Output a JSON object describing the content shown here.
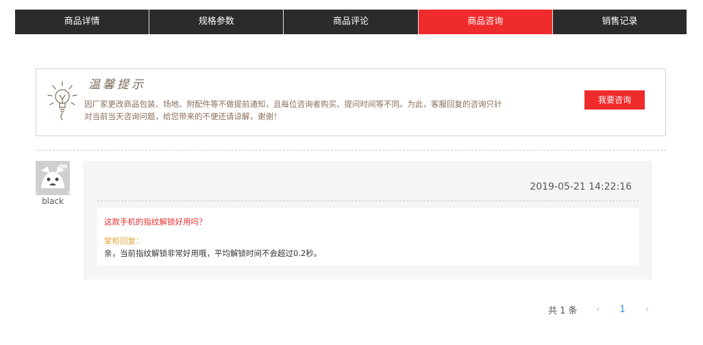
{
  "tabs": [
    {
      "label": "商品详情"
    },
    {
      "label": "规格参数"
    },
    {
      "label": "商品评论"
    },
    {
      "label": "商品咨询"
    },
    {
      "label": "销售记录"
    }
  ],
  "active_tab_index": 3,
  "notice": {
    "title": "温馨提示",
    "text": "因厂家更改商品包装、场地、附配件等不做提前通知，且每位咨询者购买、提问时间等不同。为此，客服回复的咨询只针对当前当天咨询问题，给您带来的不便还请谅解，谢谢！",
    "ask_button": "我要咨询",
    "icon": "lightbulb-icon"
  },
  "consult": {
    "username": "black",
    "avatar_icon": "avatar-icon",
    "time": "2019-05-21 14:22:16",
    "question": "这款手机的指纹解锁好用吗？",
    "reply_label": "掌柜回复：",
    "reply": "亲，当前指纹解锁非常好用哦，平均解锁时间不会超过0.2秒。"
  },
  "pagination": {
    "total_text": "共 1 条",
    "prev": "‹",
    "current": "1",
    "next": "›"
  },
  "colors": {
    "tab_bg": "#2b2b2b",
    "accent": "#f02b2b",
    "question": "#e03030",
    "reply_label": "#e8a23c",
    "page_link": "#2b8ee8"
  }
}
